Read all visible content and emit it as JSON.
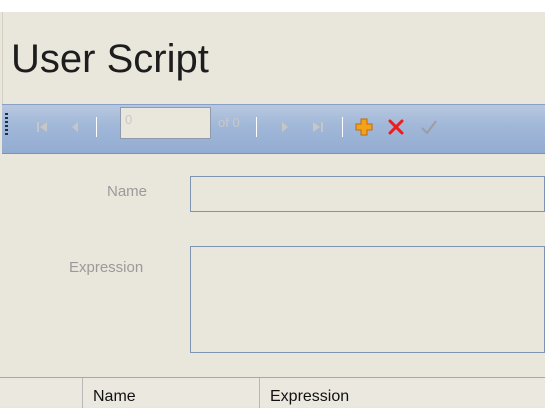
{
  "window": {
    "title": "User Script"
  },
  "navigator": {
    "position_value": "0",
    "of_label": "of 0",
    "buttons": {
      "first": "move-first-icon",
      "previous": "move-previous-icon",
      "next": "move-next-icon",
      "last": "move-last-icon",
      "add": "add-new-icon",
      "delete": "delete-icon",
      "save": "save-checkmark-icon"
    },
    "colors": {
      "toolbar_blue": "#a0b7d8",
      "add_orange": "#f6a11b",
      "delete_red": "#ee1c1c"
    }
  },
  "form": {
    "name_label": "Name",
    "name_value": "",
    "expression_label": "Expression",
    "expression_value": ""
  },
  "grid": {
    "columns": [
      "",
      "Name",
      "Expression"
    ]
  }
}
